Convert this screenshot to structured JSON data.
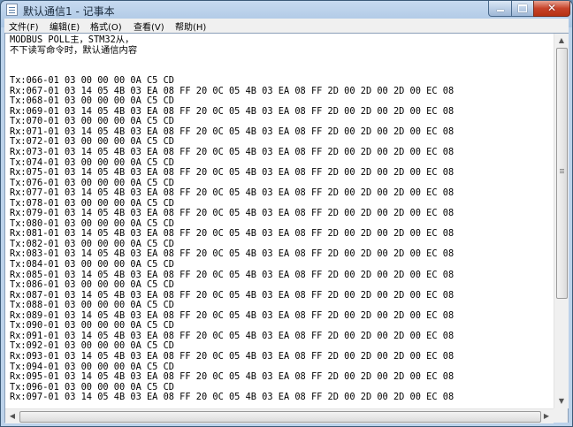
{
  "window": {
    "title": "默认通信1 - 记事本",
    "icon": "notepad-icon",
    "controls": {
      "minimize": "minimize-icon",
      "maximize": "maximize-icon",
      "close": "close-icon"
    }
  },
  "menu": [
    {
      "label": "文件(F)"
    },
    {
      "label": "编辑(E)"
    },
    {
      "label": "格式(O)"
    },
    {
      "label": "查看(V)"
    },
    {
      "label": "帮助(H)"
    }
  ],
  "document": {
    "lines": [
      "MODBUS POLL主，STM32从，",
      "不下读写命令时，默认通信内容",
      "",
      "",
      "Tx:066-01 03 00 00 00 0A C5 CD",
      "Rx:067-01 03 14 05 4B 03 EA 08 FF 20 0C 05 4B 03 EA 08 FF 2D 00 2D 00 2D 00 EC 08",
      "Tx:068-01 03 00 00 00 0A C5 CD",
      "Rx:069-01 03 14 05 4B 03 EA 08 FF 20 0C 05 4B 03 EA 08 FF 2D 00 2D 00 2D 00 EC 08",
      "Tx:070-01 03 00 00 00 0A C5 CD",
      "Rx:071-01 03 14 05 4B 03 EA 08 FF 20 0C 05 4B 03 EA 08 FF 2D 00 2D 00 2D 00 EC 08",
      "Tx:072-01 03 00 00 00 0A C5 CD",
      "Rx:073-01 03 14 05 4B 03 EA 08 FF 20 0C 05 4B 03 EA 08 FF 2D 00 2D 00 2D 00 EC 08",
      "Tx:074-01 03 00 00 00 0A C5 CD",
      "Rx:075-01 03 14 05 4B 03 EA 08 FF 20 0C 05 4B 03 EA 08 FF 2D 00 2D 00 2D 00 EC 08",
      "Tx:076-01 03 00 00 00 0A C5 CD",
      "Rx:077-01 03 14 05 4B 03 EA 08 FF 20 0C 05 4B 03 EA 08 FF 2D 00 2D 00 2D 00 EC 08",
      "Tx:078-01 03 00 00 00 0A C5 CD",
      "Rx:079-01 03 14 05 4B 03 EA 08 FF 20 0C 05 4B 03 EA 08 FF 2D 00 2D 00 2D 00 EC 08",
      "Tx:080-01 03 00 00 00 0A C5 CD",
      "Rx:081-01 03 14 05 4B 03 EA 08 FF 20 0C 05 4B 03 EA 08 FF 2D 00 2D 00 2D 00 EC 08",
      "Tx:082-01 03 00 00 00 0A C5 CD",
      "Rx:083-01 03 14 05 4B 03 EA 08 FF 20 0C 05 4B 03 EA 08 FF 2D 00 2D 00 2D 00 EC 08",
      "Tx:084-01 03 00 00 00 0A C5 CD",
      "Rx:085-01 03 14 05 4B 03 EA 08 FF 20 0C 05 4B 03 EA 08 FF 2D 00 2D 00 2D 00 EC 08",
      "Tx:086-01 03 00 00 00 0A C5 CD",
      "Rx:087-01 03 14 05 4B 03 EA 08 FF 20 0C 05 4B 03 EA 08 FF 2D 00 2D 00 2D 00 EC 08",
      "Tx:088-01 03 00 00 00 0A C5 CD",
      "Rx:089-01 03 14 05 4B 03 EA 08 FF 20 0C 05 4B 03 EA 08 FF 2D 00 2D 00 2D 00 EC 08",
      "Tx:090-01 03 00 00 00 0A C5 CD",
      "Rx:091-01 03 14 05 4B 03 EA 08 FF 20 0C 05 4B 03 EA 08 FF 2D 00 2D 00 2D 00 EC 08",
      "Tx:092-01 03 00 00 00 0A C5 CD",
      "Rx:093-01 03 14 05 4B 03 EA 08 FF 20 0C 05 4B 03 EA 08 FF 2D 00 2D 00 2D 00 EC 08",
      "Tx:094-01 03 00 00 00 0A C5 CD",
      "Rx:095-01 03 14 05 4B 03 EA 08 FF 20 0C 05 4B 03 EA 08 FF 2D 00 2D 00 2D 00 EC 08",
      "Tx:096-01 03 00 00 00 0A C5 CD",
      "Rx:097-01 03 14 05 4B 03 EA 08 FF 20 0C 05 4B 03 EA 08 FF 2D 00 2D 00 2D 00 EC 08"
    ]
  },
  "scrollbars": {
    "up_icon": "scroll-up-arrow-icon",
    "down_icon": "scroll-down-arrow-icon",
    "left_icon": "scroll-left-arrow-icon",
    "right_icon": "scroll-right-arrow-icon"
  }
}
